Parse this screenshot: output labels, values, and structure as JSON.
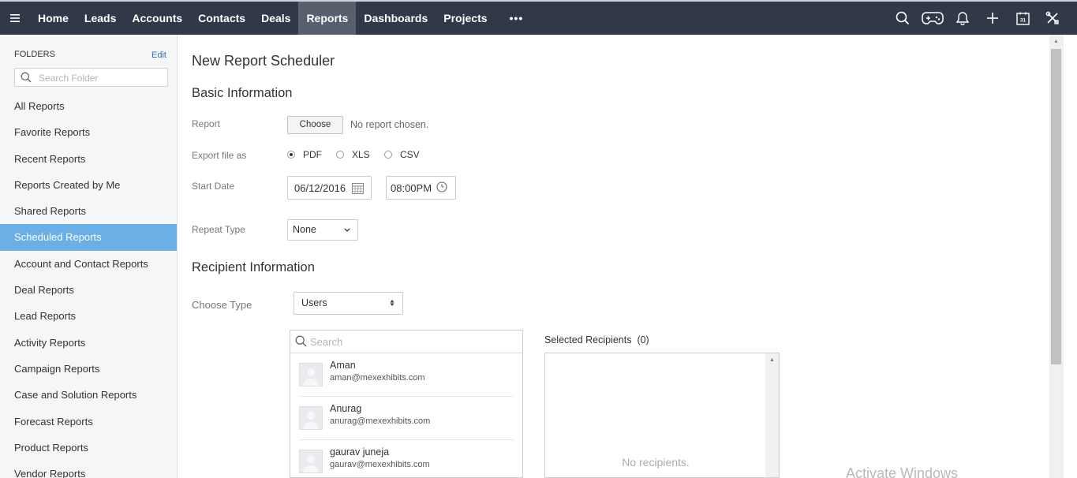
{
  "nav": {
    "menu_icon": "hamburger-icon",
    "items": [
      {
        "label": "Home"
      },
      {
        "label": "Leads"
      },
      {
        "label": "Accounts"
      },
      {
        "label": "Contacts"
      },
      {
        "label": "Deals"
      },
      {
        "label": "Reports",
        "active": true
      },
      {
        "label": "Dashboards"
      },
      {
        "label": "Projects"
      }
    ],
    "more_label": "•••",
    "icons": [
      "search-icon",
      "gamepad-icon",
      "bell-icon",
      "plus-icon",
      "calendar-icon",
      "tools-icon"
    ],
    "calendar_day": "31"
  },
  "sidebar": {
    "folders_title": "FOLDERS",
    "edit_label": "Edit",
    "search_placeholder": "Search Folder",
    "items": [
      {
        "label": "All Reports"
      },
      {
        "label": "Favorite Reports"
      },
      {
        "label": "Recent Reports"
      },
      {
        "label": "Reports Created by Me"
      },
      {
        "label": "Shared Reports"
      },
      {
        "label": "Scheduled Reports",
        "active": true
      },
      {
        "label": "Account and Contact Reports"
      },
      {
        "label": "Deal Reports"
      },
      {
        "label": "Lead Reports"
      },
      {
        "label": "Activity Reports"
      },
      {
        "label": "Campaign Reports"
      },
      {
        "label": "Case and Solution Reports"
      },
      {
        "label": "Forecast Reports"
      },
      {
        "label": "Product Reports"
      },
      {
        "label": "Vendor Reports"
      }
    ]
  },
  "form": {
    "title": "New Report Scheduler",
    "basic_section": "Basic Information",
    "report_label": "Report",
    "choose_button": "Choose",
    "no_report": "No report chosen.",
    "export_label": "Export file as",
    "export_options": [
      {
        "label": "PDF",
        "selected": true
      },
      {
        "label": "XLS",
        "selected": false
      },
      {
        "label": "CSV",
        "selected": false
      }
    ],
    "start_date_label": "Start Date",
    "start_date": "06/12/2016",
    "start_time": "08:00PM",
    "repeat_label": "Repeat Type",
    "repeat_value": "None",
    "recipient_section": "Recipient Information",
    "choose_type_label": "Choose Type",
    "choose_type_value": "Users",
    "recipient_search_placeholder": "Search",
    "users": [
      {
        "name": "Aman",
        "email": "aman@mexexhibits.com"
      },
      {
        "name": "Anurag",
        "email": "anurag@mexexhibits.com"
      },
      {
        "name": "gaurav juneja",
        "email": "gaurav@mexexhibits.com"
      }
    ],
    "selected_title": "Selected Recipients",
    "selected_count": "(0)",
    "no_recipients": "No recipients."
  },
  "watermark": "Activate Windows",
  "colors": {
    "topbar": "#313949",
    "active_nav": "#59606d",
    "active_folder": "#6ab0e6",
    "link": "#2c6fb8"
  }
}
